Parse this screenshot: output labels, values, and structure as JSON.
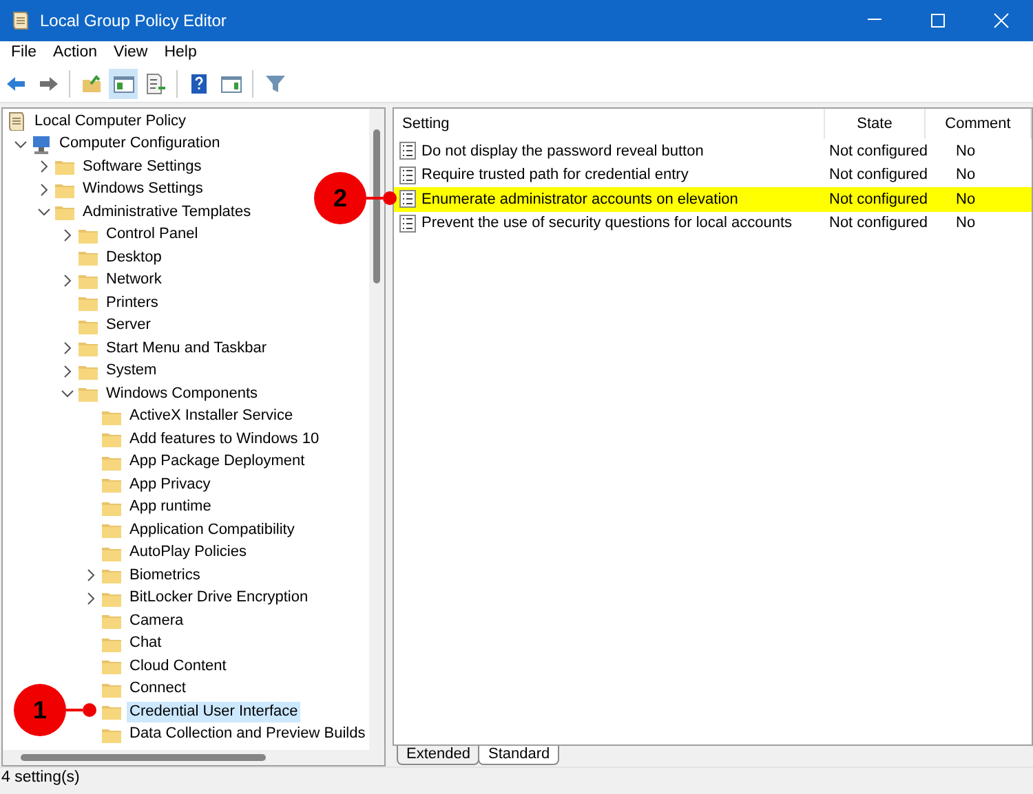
{
  "window": {
    "title": "Local Group Policy Editor"
  },
  "menu": [
    "File",
    "Action",
    "View",
    "Help"
  ],
  "toolbar": [
    {
      "kind": "back",
      "pressed": false
    },
    {
      "kind": "forward",
      "pressed": false
    },
    {
      "kind": "up",
      "pressed": false
    },
    {
      "kind": "tree",
      "pressed": true
    },
    {
      "kind": "export",
      "pressed": false
    },
    {
      "kind": "help",
      "pressed": false
    },
    {
      "kind": "properties",
      "pressed": false
    },
    {
      "kind": "filter",
      "pressed": false
    }
  ],
  "tree": [
    {
      "label": "Local Computer Policy",
      "kind": "policy",
      "selected": false,
      "children": [
        {
          "label": "Computer Configuration",
          "kind": "computer",
          "expanded": true,
          "selected": false,
          "children": [
            {
              "label": "Software Settings",
              "kind": "folder",
              "expanded": false,
              "selected": false
            },
            {
              "label": "Windows Settings",
              "kind": "folder",
              "expanded": false,
              "selected": false
            },
            {
              "label": "Administrative Templates",
              "kind": "folder",
              "expanded": true,
              "selected": false,
              "children": [
                {
                  "label": "Control Panel",
                  "kind": "folder",
                  "expanded": false,
                  "selected": false
                },
                {
                  "label": "Desktop",
                  "kind": "folder",
                  "selected": false
                },
                {
                  "label": "Network",
                  "kind": "folder",
                  "expanded": false,
                  "selected": false
                },
                {
                  "label": "Printers",
                  "kind": "folder",
                  "selected": false
                },
                {
                  "label": "Server",
                  "kind": "folder",
                  "selected": false
                },
                {
                  "label": "Start Menu and Taskbar",
                  "kind": "folder",
                  "expanded": false,
                  "selected": false
                },
                {
                  "label": "System",
                  "kind": "folder",
                  "expanded": false,
                  "selected": false
                },
                {
                  "label": "Windows Components",
                  "kind": "folder",
                  "expanded": true,
                  "selected": false,
                  "children": [
                    {
                      "label": "ActiveX Installer Service",
                      "kind": "folder",
                      "selected": false
                    },
                    {
                      "label": "Add features to Windows 10",
                      "kind": "folder",
                      "selected": false
                    },
                    {
                      "label": "App Package Deployment",
                      "kind": "folder",
                      "selected": false
                    },
                    {
                      "label": "App Privacy",
                      "kind": "folder",
                      "selected": false
                    },
                    {
                      "label": "App runtime",
                      "kind": "folder",
                      "selected": false
                    },
                    {
                      "label": "Application Compatibility",
                      "kind": "folder",
                      "selected": false
                    },
                    {
                      "label": "AutoPlay Policies",
                      "kind": "folder",
                      "selected": false
                    },
                    {
                      "label": "Biometrics",
                      "kind": "folder",
                      "expanded": false,
                      "selected": false
                    },
                    {
                      "label": "BitLocker Drive Encryption",
                      "kind": "folder",
                      "expanded": false,
                      "selected": false
                    },
                    {
                      "label": "Camera",
                      "kind": "folder",
                      "selected": false
                    },
                    {
                      "label": "Chat",
                      "kind": "folder",
                      "selected": false
                    },
                    {
                      "label": "Cloud Content",
                      "kind": "folder",
                      "selected": false
                    },
                    {
                      "label": "Connect",
                      "kind": "folder",
                      "selected": false
                    },
                    {
                      "label": "Credential User Interface",
                      "kind": "folder",
                      "selected": true
                    },
                    {
                      "label": "Data Collection and Preview Builds",
                      "kind": "folder",
                      "selected": false
                    }
                  ]
                }
              ]
            }
          ]
        }
      ]
    }
  ],
  "table": {
    "columns": [
      "Setting",
      "State",
      "Comment"
    ],
    "rows": [
      {
        "setting": "Do not display the password reveal button",
        "state": "Not configured",
        "comment": "No",
        "highlighted": false
      },
      {
        "setting": "Require trusted path for credential entry",
        "state": "Not configured",
        "comment": "No",
        "highlighted": false
      },
      {
        "setting": "Enumerate administrator accounts on elevation",
        "state": "Not configured",
        "comment": "No",
        "highlighted": true
      },
      {
        "setting": "Prevent the use of security questions for local accounts",
        "state": "Not configured",
        "comment": "No",
        "highlighted": false
      }
    ]
  },
  "tabs": [
    {
      "label": "Extended",
      "selected": false
    },
    {
      "label": "Standard",
      "selected": true
    }
  ],
  "callouts": [
    {
      "label": "1",
      "kind": "tree"
    },
    {
      "label": "2",
      "kind": "table"
    }
  ],
  "status_bar": "4 setting(s)"
}
